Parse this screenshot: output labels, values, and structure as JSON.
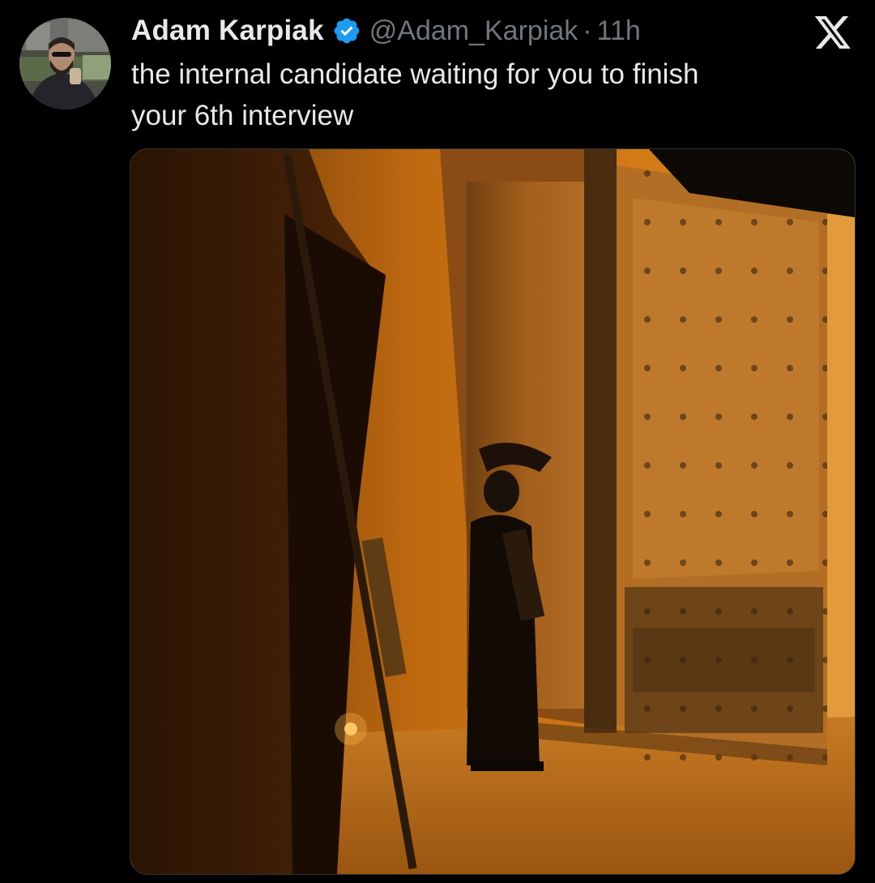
{
  "tweet": {
    "author": {
      "name": "Adam Karpiak",
      "handle": "@Adam_Karpiak",
      "verified": true,
      "avatar_icon": "profile-photo"
    },
    "separator": "·",
    "time": "11h",
    "text_lines": [
      "the internal candidate waiting for you to finish",
      "your 6th interview"
    ],
    "media_icon": "photo-spartan-guard-at-door"
  },
  "platform": {
    "logo_icon": "x-logo-icon"
  },
  "colors": {
    "background": "#000000",
    "primary_text": "#e7e9ea",
    "secondary_text": "#71767b",
    "verified_badge": "#1d9bf0"
  }
}
